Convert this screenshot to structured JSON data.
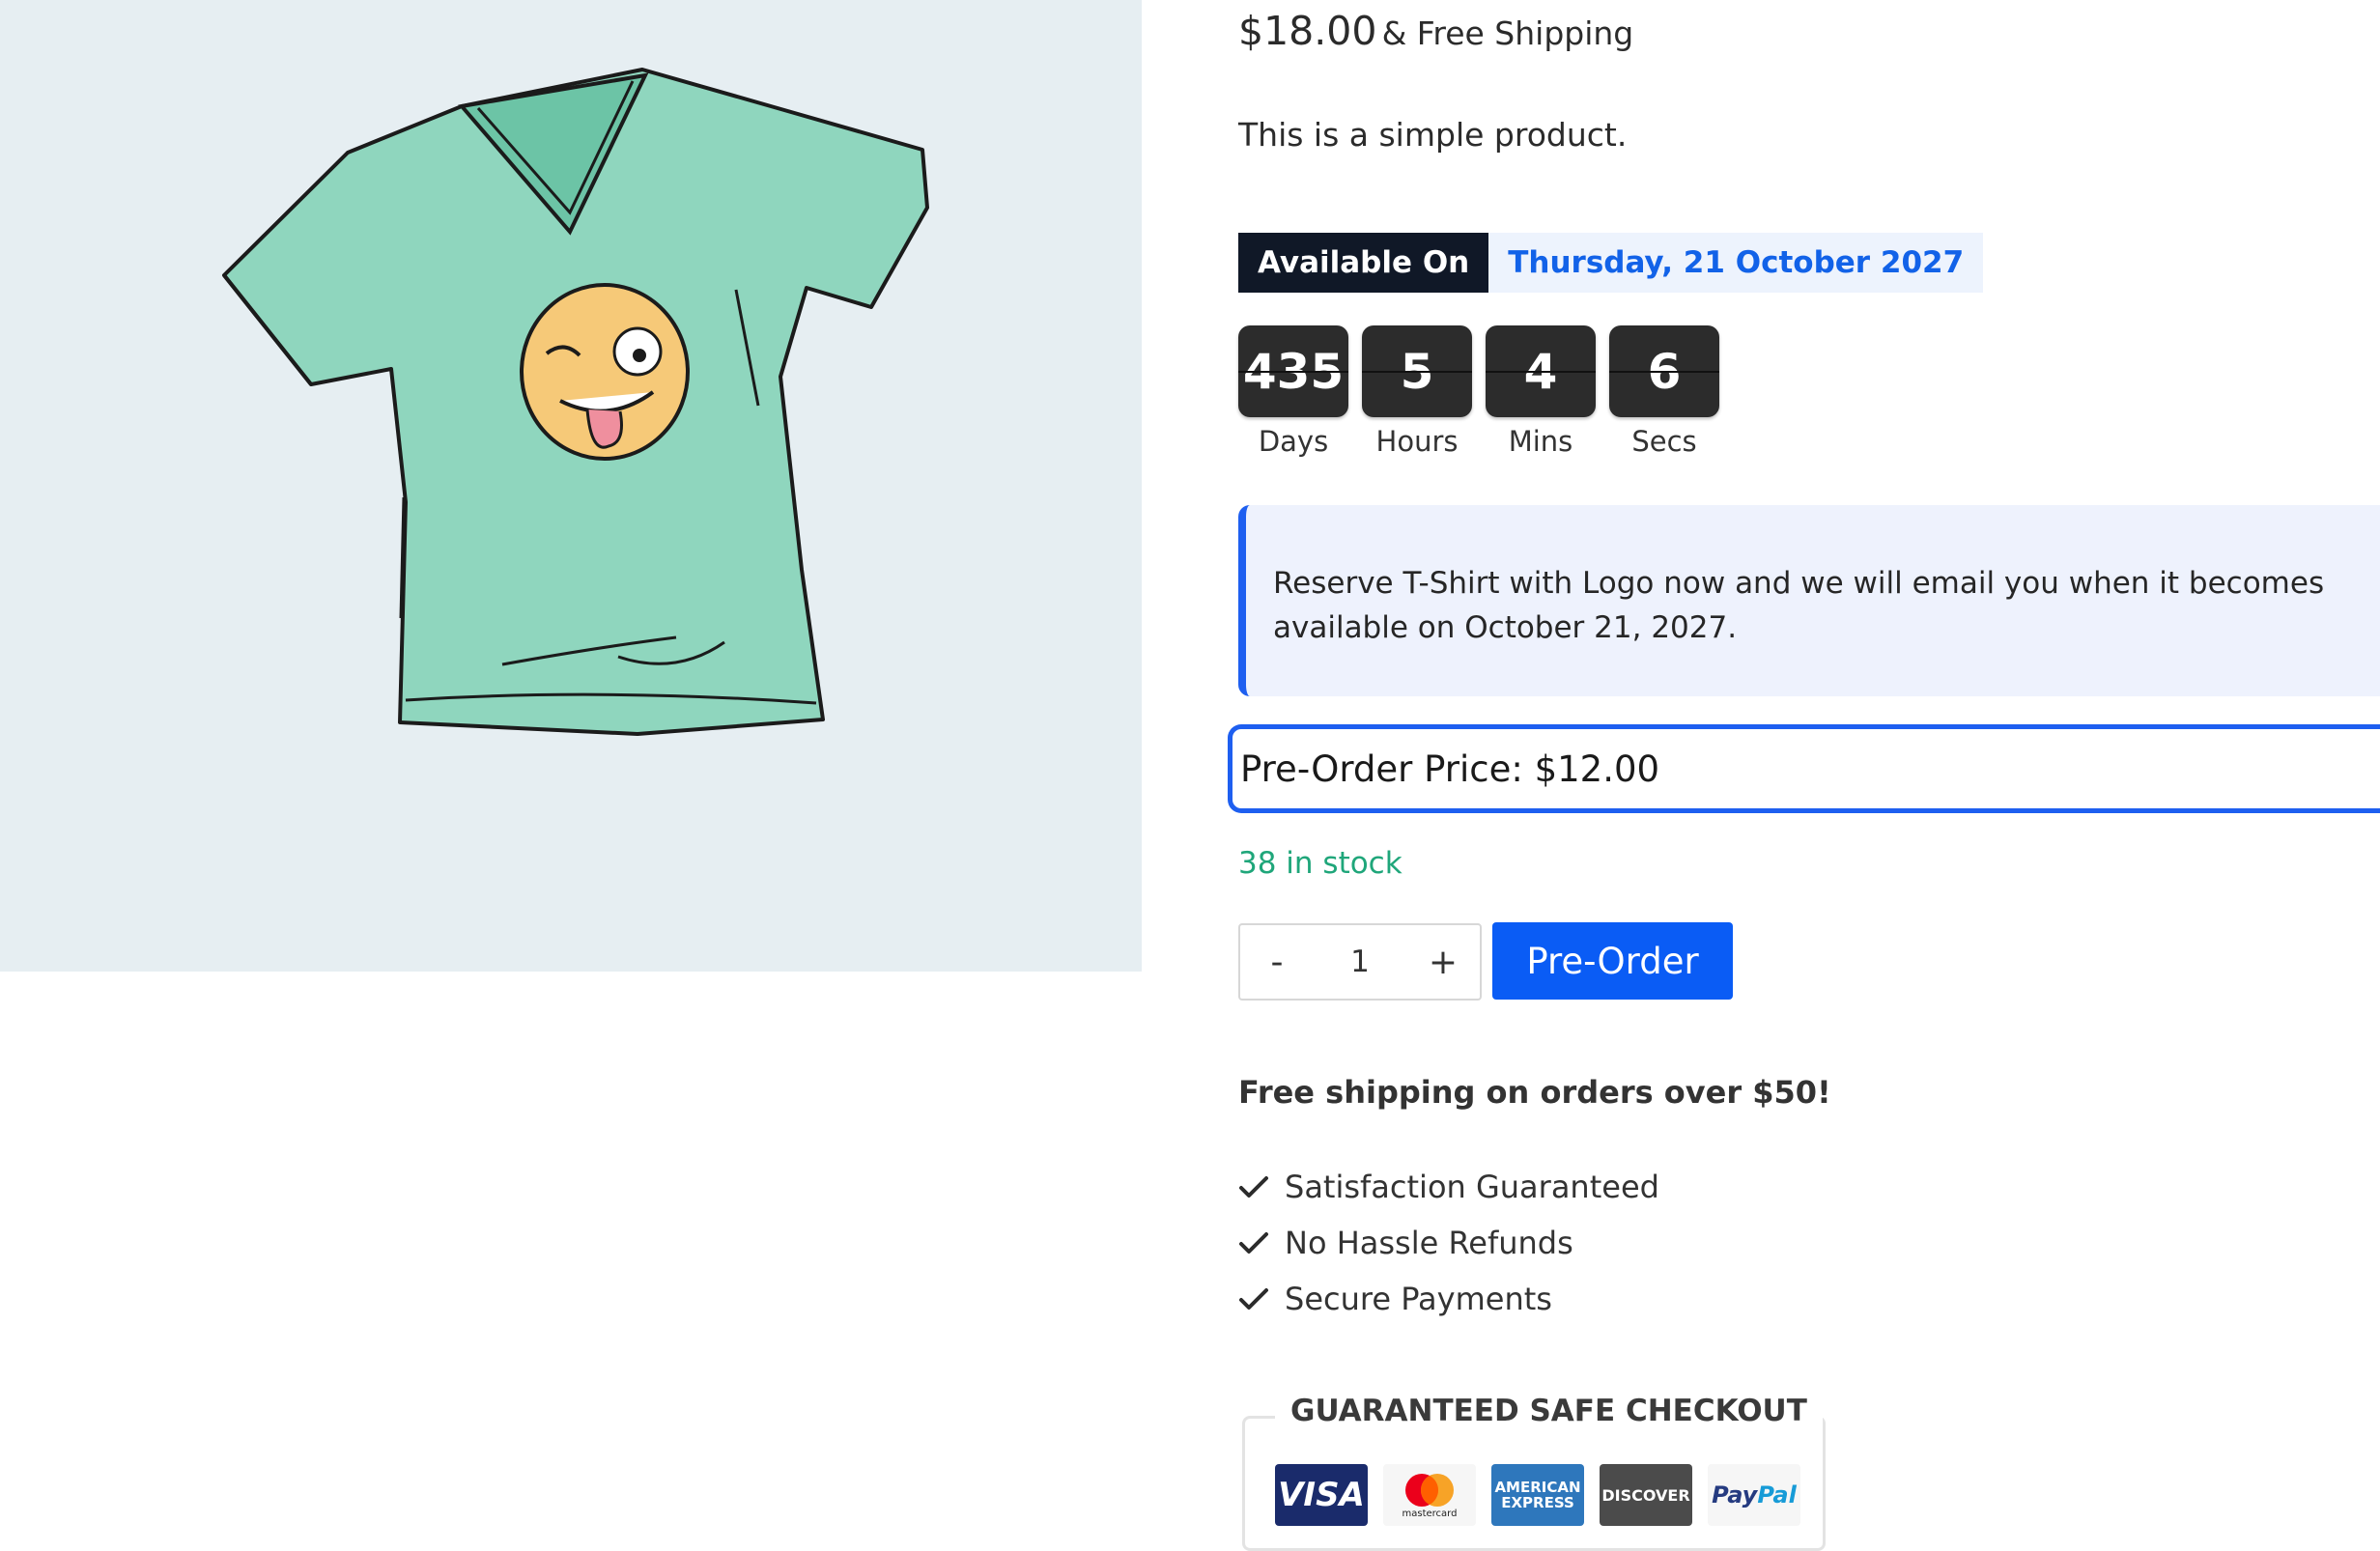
{
  "product": {
    "price": "$18.00",
    "shipping": "& Free Shipping",
    "description": "This is a simple product."
  },
  "availability": {
    "label": "Available On",
    "date": "Thursday, 21 October 2027"
  },
  "countdown": [
    {
      "value": "435",
      "label": "Days"
    },
    {
      "value": "5",
      "label": "Hours"
    },
    {
      "value": "4",
      "label": "Mins"
    },
    {
      "value": "6",
      "label": "Secs"
    }
  ],
  "notice": "Reserve T-Shirt with Logo now and we will email you when it becomes available on October 21, 2027.",
  "preorder_price": "Pre-Order Price: $12.00",
  "stock": "38 in stock",
  "quantity": {
    "minus": "-",
    "value": "1",
    "plus": "+"
  },
  "preorder_button": "Pre-Order",
  "free_shipping": "Free shipping on orders over $50!",
  "features": [
    "Satisfaction Guaranteed",
    "No Hassle Refunds",
    "Secure Payments"
  ],
  "checkout": {
    "title": "GUARANTEED SAFE CHECKOUT",
    "methods": {
      "visa": "VISA",
      "mastercard": "mastercard",
      "amex_line1": "AMERICAN",
      "amex_line2": "EXPRESS",
      "discover": "DISCOVER",
      "paypal_a": "Pay",
      "paypal_b": "Pal"
    }
  },
  "colors": {
    "accent": "#1e5ff0",
    "button": "#0a5cf5",
    "stock": "#1fa67a",
    "tshirt": "#8fd6be",
    "image_bg": "#e6eef2"
  }
}
